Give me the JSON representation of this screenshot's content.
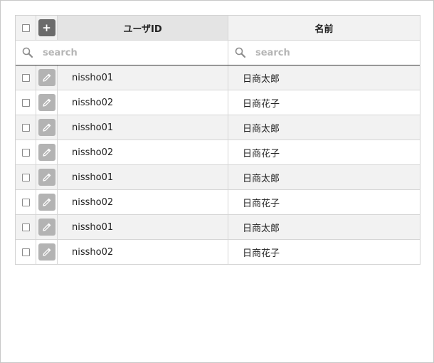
{
  "table": {
    "header": {
      "select_all": false,
      "add_glyph": "+",
      "col_user_id": "ユーザID",
      "col_name": "名前"
    },
    "filters": {
      "user_id_placeholder": "search",
      "name_placeholder": "search",
      "user_id_value": "",
      "name_value": ""
    },
    "rows": [
      {
        "user_id": "nissho01",
        "name": "日商太郎",
        "selected": false
      },
      {
        "user_id": "nissho02",
        "name": "日商花子",
        "selected": false
      },
      {
        "user_id": "nissho01",
        "name": "日商太郎",
        "selected": false
      },
      {
        "user_id": "nissho02",
        "name": "日商花子",
        "selected": false
      },
      {
        "user_id": "nissho01",
        "name": "日商太郎",
        "selected": false
      },
      {
        "user_id": "nissho02",
        "name": "日商花子",
        "selected": false
      },
      {
        "user_id": "nissho01",
        "name": "日商太郎",
        "selected": false
      },
      {
        "user_id": "nissho02",
        "name": "日商花子",
        "selected": false
      }
    ]
  },
  "icons": {
    "add": "plus-icon",
    "edit": "pencil-icon",
    "search": "search-icon"
  },
  "colors": {
    "add_button": "#6b6b6b",
    "edit_button": "#b3b3b3",
    "header_bg": "#f2f2f2",
    "sorted_header_bg": "#e4e4e4",
    "alt_row_bg": "#f2f2f2"
  }
}
